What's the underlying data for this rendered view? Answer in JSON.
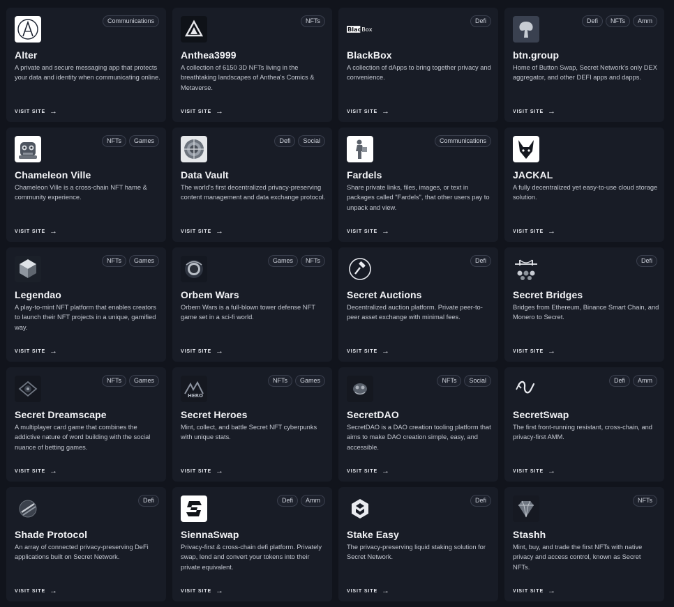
{
  "cards": [
    {
      "title": "Alter",
      "tags": [
        "Communications"
      ],
      "description": "A private and secure messaging app that protects your data and identity when communicating online.",
      "visit": "VISIT SITE",
      "icon": "alter-logo-icon",
      "arrow": "→"
    },
    {
      "title": "Anthea3999",
      "tags": [
        "NFTs"
      ],
      "description": "A collection of 6150 3D NFTs living in the breathtaking landscapes of Anthea's Comics & Metaverse.",
      "visit": "VISIT SITE",
      "icon": "anthea-logo-icon",
      "arrow": "→"
    },
    {
      "title": "BlackBox",
      "tags": [
        "Defi"
      ],
      "description": "A collection of dApps to bring together privacy and convenience.",
      "visit": "VISIT SITE",
      "icon": "blackbox-logo-icon",
      "logo_text": "BlackBox",
      "arrow": "→"
    },
    {
      "title": "btn.group",
      "tags": [
        "Defi",
        "NFTs",
        "Amm"
      ],
      "description": "Home of Button Swap, Secret Network's only DEX aggregator, and other DEFI apps and dapps.",
      "visit": "VISIT SITE",
      "icon": "btn-group-logo-icon",
      "arrow": "→"
    },
    {
      "title": "Chameleon Ville",
      "tags": [
        "NFTs",
        "Games"
      ],
      "description": "Chameleon Ville is a cross-chain NFT hame & community experience.",
      "visit": "VISIT SITE",
      "icon": "chameleon-ville-logo-icon",
      "arrow": "→"
    },
    {
      "title": "Data Vault",
      "tags": [
        "Defi",
        "Social"
      ],
      "description": "The world's first decentralized privacy-preserving content management and data exchange protocol.",
      "visit": "VISIT SITE",
      "icon": "data-vault-logo-icon",
      "arrow": "→"
    },
    {
      "title": "Fardels",
      "tags": [
        "Communications"
      ],
      "description": "Share private links, files, images, or text in packages called \"Fardels\", that other users pay to unpack and view.",
      "visit": "VISIT SITE",
      "icon": "fardels-logo-icon",
      "arrow": "→"
    },
    {
      "title": "JACKAL",
      "tags": [],
      "description": "A fully decentralized yet easy-to-use cloud storage solution.",
      "visit": "VISIT SITE",
      "icon": "jackal-logo-icon",
      "arrow": "→"
    },
    {
      "title": "Legendao",
      "tags": [
        "NFTs",
        "Games"
      ],
      "description": "A play-to-mint NFT platform that enables creators to launch their NFT projects in a unique, gamified way.",
      "visit": "VISIT SITE",
      "icon": "legendao-logo-icon",
      "arrow": "→"
    },
    {
      "title": "Orbem Wars",
      "tags": [
        "Games",
        "NFTs"
      ],
      "description": "Orbem Wars is a full-blown tower defense NFT game set in a sci-fi world.",
      "visit": "VISIT SITE",
      "icon": "orbem-wars-logo-icon",
      "arrow": "→"
    },
    {
      "title": "Secret Auctions",
      "tags": [
        "Defi"
      ],
      "description": "Decentralized auction platform. Private peer-to-peer asset exchange with minimal fees.",
      "visit": "VISIT SITE",
      "icon": "gavel-logo-icon",
      "arrow": "→"
    },
    {
      "title": "Secret Bridges",
      "tags": [
        "Defi"
      ],
      "description": "Bridges from Ethereum, Binance Smart Chain, and Monero to Secret.",
      "visit": "VISIT SITE",
      "icon": "bridge-logo-icon",
      "arrow": "→"
    },
    {
      "title": "Secret Dreamscape",
      "tags": [
        "NFTs",
        "Games"
      ],
      "description": "A multiplayer card game that combines the addictive nature of word building with the social nuance of betting games.",
      "visit": "VISIT SITE",
      "icon": "dreamscape-logo-icon",
      "arrow": "→"
    },
    {
      "title": "Secret Heroes",
      "tags": [
        "NFTs",
        "Games"
      ],
      "description": "Mint, collect, and battle Secret NFT cyberpunks with unique stats.",
      "visit": "VISIT SITE",
      "icon": "secret-heroes-logo-icon",
      "arrow": "→"
    },
    {
      "title": "SecretDAO",
      "tags": [
        "NFTs",
        "Social"
      ],
      "description": "SecretDAO is a DAO creation tooling platform that aims to make DAO creation simple, easy, and accessible.",
      "visit": "VISIT SITE",
      "icon": "secretdao-logo-icon",
      "arrow": "→"
    },
    {
      "title": "SecretSwap",
      "tags": [
        "Defi",
        "Amm"
      ],
      "description": "The first front-running resistant, cross-chain, and privacy-first AMM.",
      "visit": "VISIT SITE",
      "icon": "secretswap-logo-icon",
      "arrow": "→"
    },
    {
      "title": "Shade Protocol",
      "tags": [
        "Defi"
      ],
      "description": "An array of connected privacy-preserving DeFi applications built on Secret Network.",
      "visit": "VISIT SITE",
      "icon": "shade-protocol-logo-icon",
      "arrow": "→"
    },
    {
      "title": "SiennaSwap",
      "tags": [
        "Defi",
        "Amm"
      ],
      "description": "Privacy-first & cross-chain defi platform. Privately swap, lend and convert your tokens into their private equivalent.",
      "visit": "VISIT SITE",
      "icon": "siennaswap-logo-icon",
      "arrow": "→"
    },
    {
      "title": "Stake Easy",
      "tags": [
        "Defi"
      ],
      "description": "The privacy-preserving liquid staking solution for Secret Network.",
      "visit": "VISIT SITE",
      "icon": "stake-easy-logo-icon",
      "arrow": "→"
    },
    {
      "title": "Stashh",
      "tags": [
        "NFTs"
      ],
      "description": "Mint, buy, and trade the first NFTs with native privacy and access control, known as Secret NFTs.",
      "visit": "VISIT SITE",
      "icon": "stashh-logo-icon",
      "arrow": "→"
    }
  ]
}
